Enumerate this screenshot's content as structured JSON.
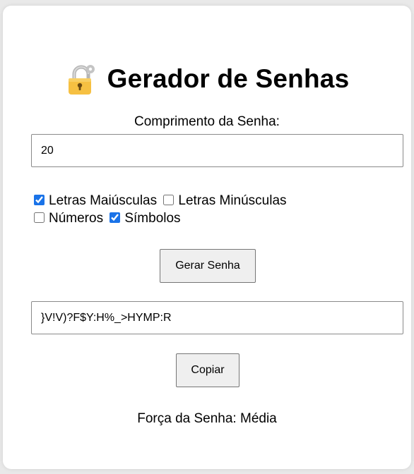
{
  "header": {
    "title": "Gerador de Senhas",
    "icon": "lock-icon"
  },
  "length": {
    "label": "Comprimento da Senha:",
    "value": "20"
  },
  "options": [
    {
      "label": "Letras Maiúsculas",
      "checked": true
    },
    {
      "label": "Letras Minúsculas",
      "checked": false
    },
    {
      "label": "Números",
      "checked": false
    },
    {
      "label": "Símbolos",
      "checked": true
    }
  ],
  "actions": {
    "generate_label": "Gerar Senha",
    "copy_label": "Copiar"
  },
  "output": {
    "password": "}V!V)?F$Y:H%_>HYMP:R"
  },
  "strength": {
    "text": "Força da Senha: Média"
  },
  "colors": {
    "lock_body": "#f6c042",
    "lock_shackle": "#b8b8b8",
    "checkbox_accent": "#1a73e8"
  }
}
